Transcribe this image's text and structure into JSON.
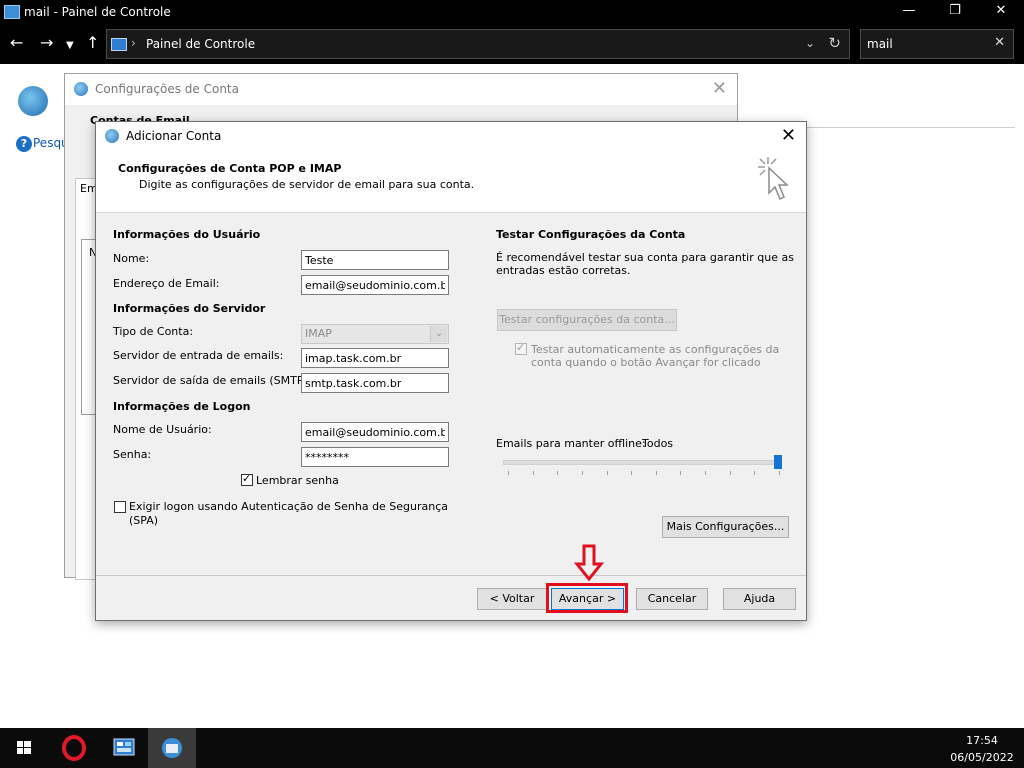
{
  "explorer": {
    "title": "mail - Painel de Controle",
    "address_path": "Painel de Controle",
    "search_value": "mail"
  },
  "control_panel": {
    "help_link": "Pesqu"
  },
  "account_window": {
    "title": "Configurações de Conta",
    "header": "Contas de Email",
    "tab_label": "Em",
    "list_label": "N"
  },
  "dialog": {
    "title": "Adicionar Conta",
    "header_title": "Configurações de Conta POP e IMAP",
    "header_subtitle": "Digite as configurações de servidor de email para sua conta.",
    "user_info": {
      "section": "Informações do Usuário",
      "name_label": "Nome:",
      "name_value": "Teste",
      "email_label": "Endereço de Email:",
      "email_value": "email@seudominio.com.br"
    },
    "server_info": {
      "section": "Informações do Servidor",
      "account_type_label": "Tipo de Conta:",
      "account_type_value": "IMAP",
      "incoming_label": "Servidor de entrada de emails:",
      "incoming_value": "imap.task.com.br",
      "outgoing_label": "Servidor de saída de emails (SMTP):",
      "outgoing_value": "smtp.task.com.br"
    },
    "logon_info": {
      "section": "Informações de Logon",
      "username_label": "Nome de Usuário:",
      "username_value": "email@seudominio.com.br",
      "password_label": "Senha:",
      "password_value": "********",
      "remember_label": "Lembrar senha",
      "spa_label_1": "Exigir logon usando Autenticação de Senha de Segurança",
      "spa_label_2": "(SPA)"
    },
    "test": {
      "section": "Testar Configurações da Conta",
      "desc_1": "É recomendável testar sua conta para garantir que as",
      "desc_2": "entradas estão corretas.",
      "button": "Testar configurações da conta...",
      "auto_1": "Testar automaticamente as configurações da",
      "auto_2": "conta quando o botão Avançar for clicado"
    },
    "offline": {
      "label": "Emails para manter offline:",
      "value": "Todos",
      "slider_fraction": 1.0
    },
    "more_settings": "Mais Configurações...",
    "buttons": {
      "back": "< Voltar",
      "next": "Avançar >",
      "cancel": "Cancelar",
      "help": "Ajuda"
    }
  },
  "taskbar": {
    "time": "17:54",
    "date": "06/05/2022"
  },
  "colors": {
    "highlight": "#e0101f",
    "accent": "#0078d7"
  }
}
